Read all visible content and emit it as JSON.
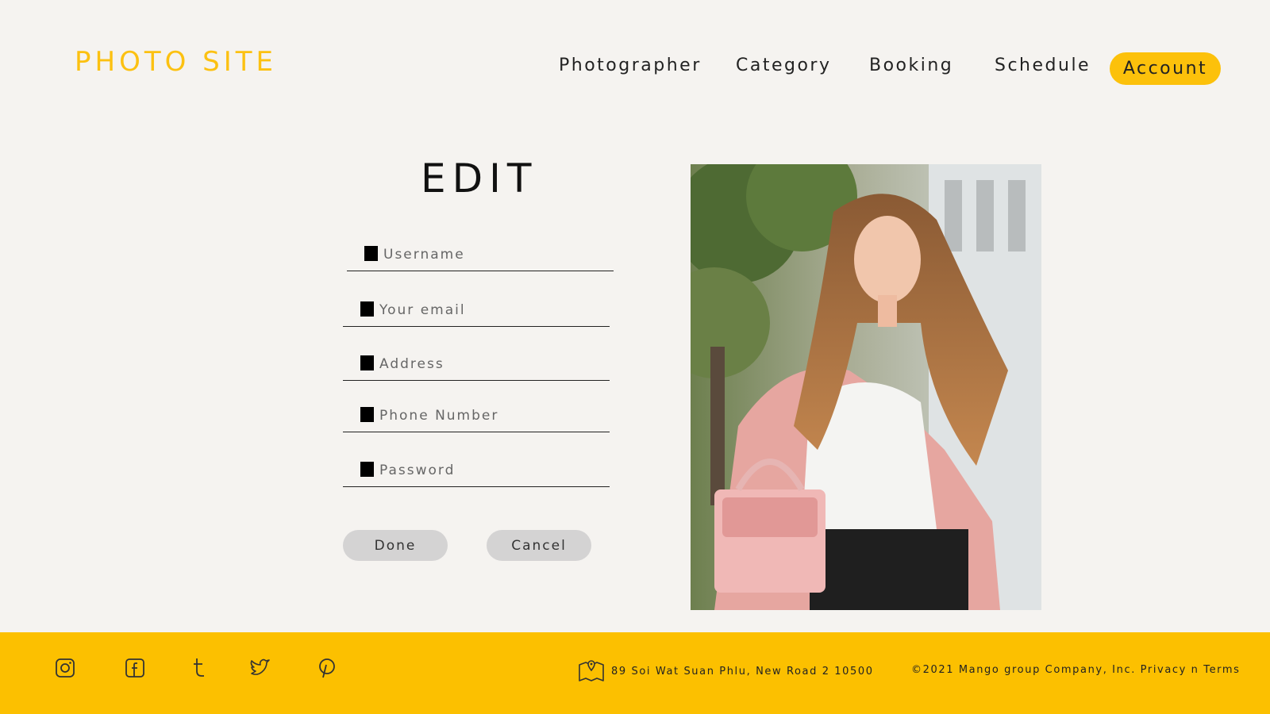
{
  "header": {
    "logo": "PHOTO SITE",
    "nav": [
      "Photographer",
      "Category",
      "Booking",
      "Schedule"
    ],
    "account": "Account"
  },
  "form": {
    "title": "EDIT",
    "fields": [
      {
        "placeholder": "Username"
      },
      {
        "placeholder": "Your email"
      },
      {
        "placeholder": "Address"
      },
      {
        "placeholder": "Phone Number"
      },
      {
        "placeholder": "Password"
      }
    ],
    "done": "Done",
    "cancel": "Cancel"
  },
  "footer": {
    "social": [
      "instagram-icon",
      "facebook-icon",
      "tumblr-icon",
      "twitter-icon",
      "pinterest-icon"
    ],
    "address": "89 Soi Wat Suan Phlu, New Road 2 10500",
    "copyright": "©2021 Mango group Company, Inc. Privacy n Terms"
  },
  "colors": {
    "accent": "#fcc111",
    "footer": "#fcc000",
    "background": "#f5f3f0",
    "button": "#d4d3d3"
  }
}
